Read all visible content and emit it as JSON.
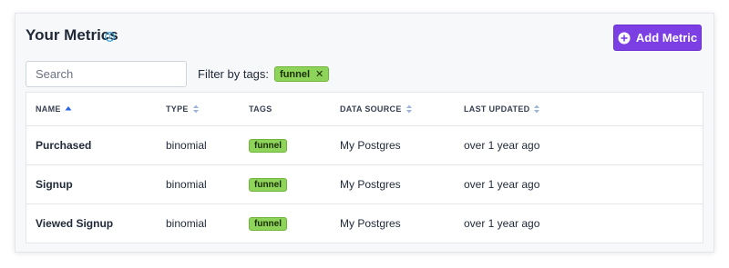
{
  "header": {
    "title": "Your Metrics",
    "info_icon": "info-icon",
    "add_button_label": "Add Metric",
    "add_button_icon": "plus-circle-icon",
    "accent_color": "#7b3fe4"
  },
  "search": {
    "placeholder": "Search",
    "value": ""
  },
  "filter": {
    "label": "Filter by tags:",
    "active_tags": [
      {
        "label": "funnel",
        "remove_icon": "close-icon"
      }
    ],
    "tag_color": "#8fd45a"
  },
  "table": {
    "columns": [
      {
        "label": "NAME",
        "sort": "ascending"
      },
      {
        "label": "TYPE",
        "sort": "sortable"
      },
      {
        "label": "TAGS",
        "sort": "none"
      },
      {
        "label": "DATA SOURCE",
        "sort": "sortable"
      },
      {
        "label": "LAST UPDATED",
        "sort": "sortable"
      }
    ],
    "rows": [
      {
        "name": "Purchased",
        "type": "binomial",
        "tag": "funnel",
        "source": "My Postgres",
        "updated": "over 1 year ago"
      },
      {
        "name": "Signup",
        "type": "binomial",
        "tag": "funnel",
        "source": "My Postgres",
        "updated": "over 1 year ago"
      },
      {
        "name": "Viewed Signup",
        "type": "binomial",
        "tag": "funnel",
        "source": "My Postgres",
        "updated": "over 1 year ago"
      }
    ]
  }
}
